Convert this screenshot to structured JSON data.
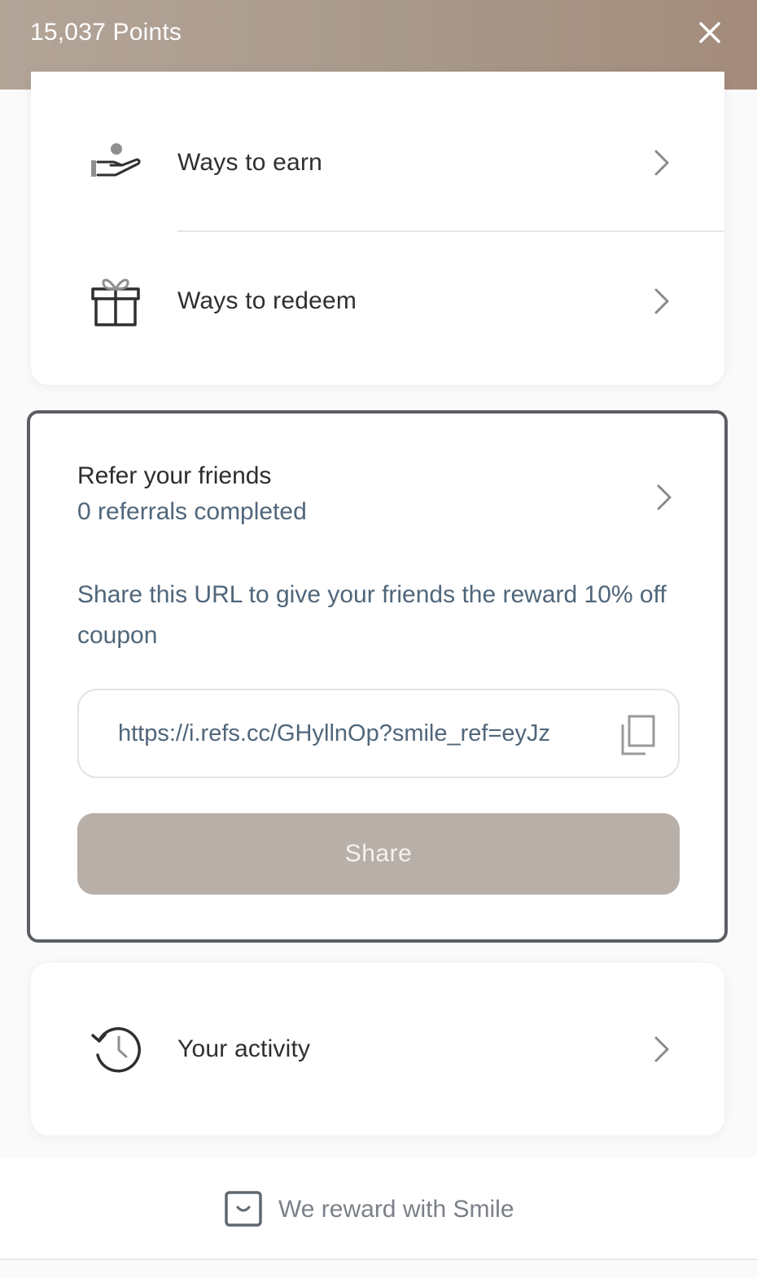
{
  "header": {
    "points_label": "15,037 Points",
    "close_icon": "close-icon"
  },
  "menu": {
    "items": [
      {
        "label": "Ways to earn",
        "icon": "hand-coin-icon"
      },
      {
        "label": "Ways to redeem",
        "icon": "gift-icon"
      }
    ]
  },
  "referral": {
    "title": "Refer your friends",
    "subtitle": "0 referrals completed",
    "description": "Share this URL to give your friends the reward 10% off coupon",
    "url": "https://i.refs.cc/GHyllnOp?smile_ref=eyJz",
    "copy_icon": "copy-icon",
    "share_label": "Share"
  },
  "activity": {
    "label": "Your activity",
    "icon": "history-icon"
  },
  "footer": {
    "text": "We reward with Smile",
    "icon": "smile-logo-icon"
  },
  "colors": {
    "header_gradient_start": "#b3a498",
    "header_gradient_end": "#a38b7b",
    "share_button": "#b7afa8",
    "secondary_text": "#50667a",
    "referral_border": "#5b5f63"
  }
}
